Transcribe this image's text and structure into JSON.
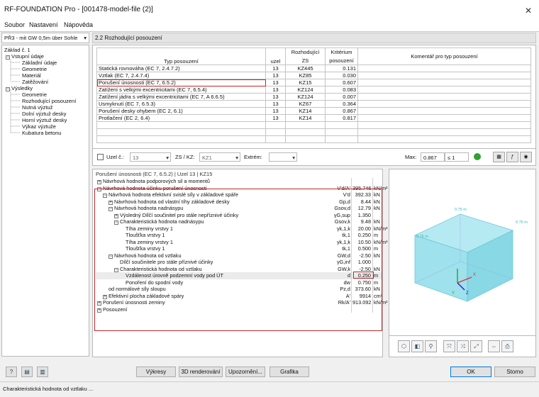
{
  "window": {
    "title": "RF-FOUNDATION Pro - [001478-model-file (2)]",
    "close": "✕"
  },
  "menu": [
    "Soubor",
    "Nastavení",
    "Nápověda"
  ],
  "case_combo": {
    "value": "PŘ3 - mit GW 0,5m über Sohle",
    "arrow": "▾"
  },
  "tree": {
    "root": "Základ č. 1",
    "inputs": "Vstupní údaje",
    "inputs_items": [
      "Základní údaje",
      "Geometrie",
      "Materiál",
      "Zatěžování"
    ],
    "results": "Výsledky",
    "results_items": [
      "Geometrie",
      "Rozhodující posouzení",
      "Nutná výztuž",
      "Dolní výztuž desky",
      "Horní výztuž desky",
      "Výkaz výztuže",
      "Kubatura betonu"
    ]
  },
  "section_title": "2.2 Rozhodující posouzení",
  "design_table": {
    "headers": {
      "type": "Typ posouzení",
      "node": "uzel",
      "zs": "ZS",
      "zs_top": "Rozhodující",
      "crit": "posouzení",
      "crit_top": "Kritérium",
      "comment": "Komentář pro typ posouzení"
    },
    "rows": [
      {
        "type": "Statická rovnováha (EC 7, 2.4.7.2)",
        "node": "13",
        "zs": "KZ445",
        "crit": "0.131"
      },
      {
        "type": "Vztlak (EC 7, 2.4.7.4)",
        "node": "13",
        "zs": "KZ85",
        "crit": "0.030"
      },
      {
        "type": "Porušení únosnosti (EC 7, 6.5.2)",
        "node": "13",
        "zs": "KZ15",
        "crit": "0.607"
      },
      {
        "type": "Zatížení s velkými excentricitami (EC 7, 6.5.4)",
        "node": "13",
        "zs": "KZ124",
        "crit": "0.083"
      },
      {
        "type": "Zatížení jádra s velkými excentricitami (EC 7, A 6.6.5)",
        "node": "13",
        "zs": "KZ124",
        "crit": "0.007"
      },
      {
        "type": "Usmyknutí (EC 7, 6.5.3)",
        "node": "13",
        "zs": "KZ67",
        "crit": "0.364"
      },
      {
        "type": "Porušení desky ohybem (EC 2, 6.1)",
        "node": "13",
        "zs": "KZ14",
        "crit": "0.867"
      },
      {
        "type": "Protlačení (EC 2, 6.4)",
        "node": "13",
        "zs": "KZ14",
        "crit": "0.817"
      }
    ]
  },
  "filter": {
    "node_label": "Uzel č.:",
    "node_value": "13",
    "zs_label": "ZS / KZ:",
    "zs_value": "KZ1",
    "extrem_label": "Extrém:",
    "max_label": "Max:",
    "max_value": "0.867",
    "max_cond": "≤ 1"
  },
  "details": {
    "caption": "Porušení únosnosti (EC 7, 6.5.2) | Uzel 13 | KZ15",
    "rows": [
      {
        "l": "Návrhová hodnota podporových sil a momentů",
        "ind": 0,
        "box": "+",
        "sym": "",
        "val": "",
        "unit": ""
      },
      {
        "l": "Návrhová hodnota účinku porušení únosnosti",
        "ind": 0,
        "box": "−",
        "sym": "V'd/A'",
        "val": "395.746",
        "unit": "kN/m²"
      },
      {
        "l": "Návrhová hodnota efektivní svislé síly v základové spáře",
        "ind": 1,
        "box": "−",
        "sym": "V'd",
        "val": "392.33",
        "unit": "kN"
      },
      {
        "l": "Návrhová hodnota od vlastní tíhy základové desky",
        "ind": 2,
        "box": "+",
        "sym": "Gp,d",
        "val": "8.44",
        "unit": "kN"
      },
      {
        "l": "Návrhová hodnota nadnásypu",
        "ind": 2,
        "box": "−",
        "sym": "Gsov,d",
        "val": "12.79",
        "unit": "kN"
      },
      {
        "l": "Výsledný Dílčí součinitel pro stále nepříznivé účinky",
        "ind": 3,
        "box": "+",
        "sym": "γG,sup",
        "val": "1.350",
        "unit": ""
      },
      {
        "l": "Charakteristická hodnota nadnásypu",
        "ind": 3,
        "box": "−",
        "sym": "Gsov,k",
        "val": "9.48",
        "unit": "kN"
      },
      {
        "l": "Tíha zeminy vrstvy 1",
        "ind": 5,
        "box": "",
        "sym": "γk,1,k",
        "val": "20.00",
        "unit": "kN/m³"
      },
      {
        "l": "Tloušťka vrstvy 1",
        "ind": 5,
        "box": "",
        "sym": "tk,1",
        "val": "0.250",
        "unit": "m"
      },
      {
        "l": "Tíha zeminy vrstvy 1",
        "ind": 5,
        "box": "",
        "sym": "γk,1,k",
        "val": "10.50",
        "unit": "kN/m³"
      },
      {
        "l": "Tloušťka vrstvy 1",
        "ind": 5,
        "box": "",
        "sym": "tk,1",
        "val": "0.500",
        "unit": "m"
      },
      {
        "l": "Návrhová hodnota od vztlaku",
        "ind": 2,
        "box": "−",
        "sym": "GW,d",
        "val": "-2.50",
        "unit": "kN"
      },
      {
        "l": "Dílčí součinitele pro stále příznivé účinky",
        "ind": 4,
        "box": "",
        "sym": "γG,inf",
        "val": "1.000",
        "unit": ""
      },
      {
        "l": "Charakteristická hodnota od vztlaku",
        "ind": 3,
        "box": "−",
        "sym": "GW,k",
        "val": "-2.50",
        "unit": "kN"
      },
      {
        "l": "Vzdálenost úrovně podzemní vody pod ÚT",
        "ind": 5,
        "box": "",
        "sym": "d",
        "val": "0.250",
        "unit": "m",
        "shade": true
      },
      {
        "l": "Ponoření do spodní vody",
        "ind": 5,
        "box": "",
        "sym": "dw",
        "val": "0.750",
        "unit": "m"
      },
      {
        "l": "od normálové síly sloupu",
        "ind": 2,
        "box": "",
        "sym": "Pz,d",
        "val": "373.60",
        "unit": "kN"
      },
      {
        "l": "Efektivní plocha základové spáry",
        "ind": 1,
        "box": "+",
        "sym": "A'",
        "val": "9914",
        "unit": "cm²"
      },
      {
        "l": "Porušení únosnosti zeminy",
        "ind": 0,
        "box": "+",
        "sym": "Rk/A'",
        "val": "913.092",
        "unit": "kN/m²"
      },
      {
        "l": "Posouzení",
        "ind": 0,
        "box": "+",
        "sym": "",
        "val": "",
        "unit": ""
      }
    ]
  },
  "view3d": {
    "dim1": "0.75 m",
    "dim2": "0.75 m",
    "dim3": "0.75 m",
    "ax_x": "X",
    "ax_y": "Y",
    "ax_z": "Z"
  },
  "buttons": {
    "vykresy": "Výkresy",
    "render3d": "3D renderování",
    "upozorneni": "Upozornění...",
    "grafika": "Grafika",
    "ok": "OK",
    "storno": "Storno"
  },
  "status": "Charakteristická hodnota od vztlaku ..."
}
